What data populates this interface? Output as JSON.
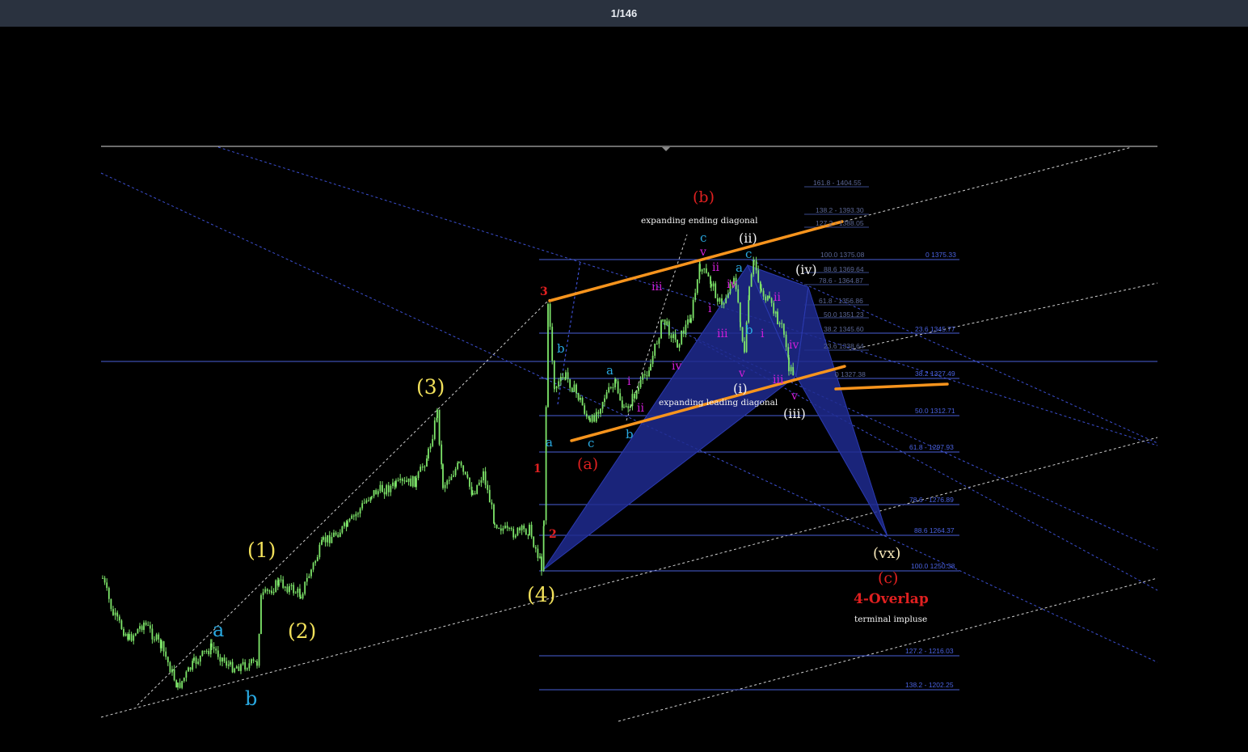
{
  "viewer": {
    "counter": "1/146"
  },
  "chart_data": {
    "type": "line",
    "description_note": "",
    "price_axis": {
      "labels_shown": false
    },
    "fib_levels_right": [
      {
        "label": "0 1375.33"
      },
      {
        "label": "23.6 1345.77"
      },
      {
        "label": "38.2 1327.49"
      },
      {
        "label": "50.0 1312.71"
      },
      {
        "label": "61.8 - 1297.93"
      },
      {
        "label": "78.6 - 1276.89"
      },
      {
        "label": "88.6 1264.37"
      },
      {
        "label": "100.0 1250.38"
      },
      {
        "label": "127.2 - 1216.03"
      },
      {
        "label": "138.2 - 1202.25"
      }
    ],
    "fib_levels_mid": [
      {
        "label": "161.8 - 1404.55"
      },
      {
        "label": "138.2 - 1393.30"
      },
      {
        "label": "127.2 - 1388.05"
      },
      {
        "label": "100.0 1375.08"
      },
      {
        "label": "88.6 1369.64"
      },
      {
        "label": "78.6 - 1364.87"
      },
      {
        "label": "61.8 - 1356.86"
      },
      {
        "label": "50.0 1351.23"
      },
      {
        "label": "38.2 1345.60"
      },
      {
        "label": "23.6 1338.64"
      },
      {
        "label": "0 1327.38"
      }
    ],
    "wave_labels": {
      "w1": "(1)",
      "w2": "(2)",
      "w3": "(3)",
      "w4": "(4)",
      "a_low": "a",
      "b_low": "b",
      "r1": "1",
      "r2": "2",
      "r3": "3",
      "a_paren": "(a)",
      "b_paren": "(b)",
      "c_paren": "(c)",
      "i_paren": "(i)",
      "ii_paren": "(ii)",
      "iii_paren": "(iii)",
      "iv_paren": "(iv)",
      "vx_paren": "(vx)",
      "blue_a1": "a",
      "blue_b1": "b",
      "blue_a2": "a",
      "blue_b2": "b",
      "blue_c1": "c",
      "blue_c2": "c",
      "blue_a3": "a",
      "blue_c3": "c",
      "blue_b3": "b",
      "m_i1": "i",
      "m_ii1": "ii",
      "m_iii1": "iii",
      "m_iv1": "iv",
      "m_v1": "v",
      "m_i2": "i",
      "m_ii2": "ii",
      "m_iii2": "iii",
      "m_iv2": "iv",
      "m_v2": "v",
      "m_i3": "i",
      "m_ii3": "ii",
      "m_iii3": "iii",
      "m_iv3": "iv",
      "m_v3": "v"
    },
    "annotations": {
      "ending_diagonal": "expanding ending diagonal",
      "leading_diagonal": "expanding leading diagonal",
      "overlap": "4-Overlap",
      "terminal": "terminal impluse"
    },
    "colors": {
      "candles": "#7ee66a",
      "orange_lines": "#f7941d",
      "fib_lines": "#4a5fd9",
      "harmonic_fill": "#1f2a8f",
      "yellow_labels": "#f1e05a",
      "cyan_labels": "#29a8e0",
      "red_labels": "#e02020",
      "magenta_labels": "#d01ed8"
    }
  }
}
